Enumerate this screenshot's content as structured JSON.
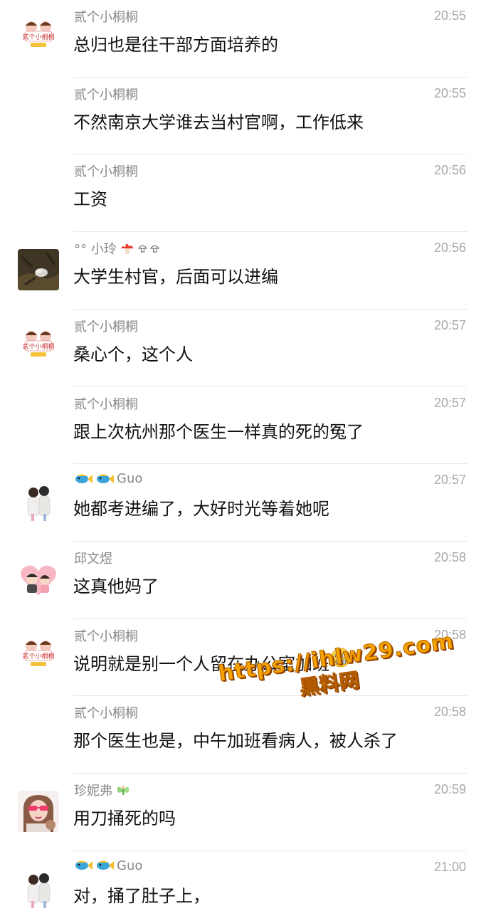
{
  "messages": [
    {
      "sender": "贰个小桐桐",
      "time": "20:55",
      "text": "总归也是往干部方面培养的",
      "avatar": "tongtong-avatar"
    },
    {
      "sender": "贰个小桐桐",
      "time": "20:55",
      "text": "不然南京大学谁去当村官啊，工作低来",
      "avatar": null
    },
    {
      "sender": "贰个小桐桐",
      "time": "20:56",
      "text": "工资",
      "avatar": null
    },
    {
      "sender": "°° 小玲",
      "time": "20:56",
      "text": "大学生村官，后面可以进编",
      "avatar": "xiaoling-avatar",
      "sender_icons": [
        "mushroom-icon",
        "mushroom-outline-icon",
        "mushroom-outline-icon"
      ]
    },
    {
      "sender": "贰个小桐桐",
      "time": "20:57",
      "text": "桑心个，这个人",
      "avatar": "tongtong-avatar"
    },
    {
      "sender": "贰个小桐桐",
      "time": "20:57",
      "text": "跟上次杭州那个医生一样真的死的冤了",
      "avatar": null
    },
    {
      "sender": "Guo",
      "time": "20:57",
      "text": "她都考进编了，大好时光等着她呢",
      "avatar": "guo-avatar",
      "sender_icons": [
        "fish-icon",
        "fish-icon"
      ]
    },
    {
      "sender": "邱文煜",
      "time": "20:58",
      "text": "这真他妈了",
      "avatar": "qiuwenyu-avatar"
    },
    {
      "sender": "贰个小桐桐",
      "time": "20:58",
      "text": "说明就是别一个人留在办公室加班",
      "avatar": "tongtong-avatar",
      "trailing_emoji": "grimace-face-icon"
    },
    {
      "sender": "贰个小桐桐",
      "time": "20:58",
      "text": "那个医生也是，中午加班看病人，被人杀了",
      "avatar": null
    },
    {
      "sender": "珍妮弗",
      "time": "20:59",
      "text": "用刀捅死的吗",
      "avatar": "jennifer-avatar",
      "sender_icons": [
        "fairy-icon"
      ]
    },
    {
      "sender": "Guo",
      "time": "21:00",
      "text": "对，捅了肚子上，",
      "avatar": "guo-avatar",
      "sender_icons": [
        "fish-icon",
        "fish-icon"
      ]
    }
  ],
  "avatar_text": {
    "tongtong": "贰个小桐桐"
  },
  "watermark": {
    "line1": "https://ihlw29.com",
    "line2": "黑料网"
  },
  "colors": {
    "sender": "#888888",
    "time": "#a8a8a8",
    "message": "#111111",
    "divider": "#e6e6e6",
    "watermark": "#f5a400"
  }
}
